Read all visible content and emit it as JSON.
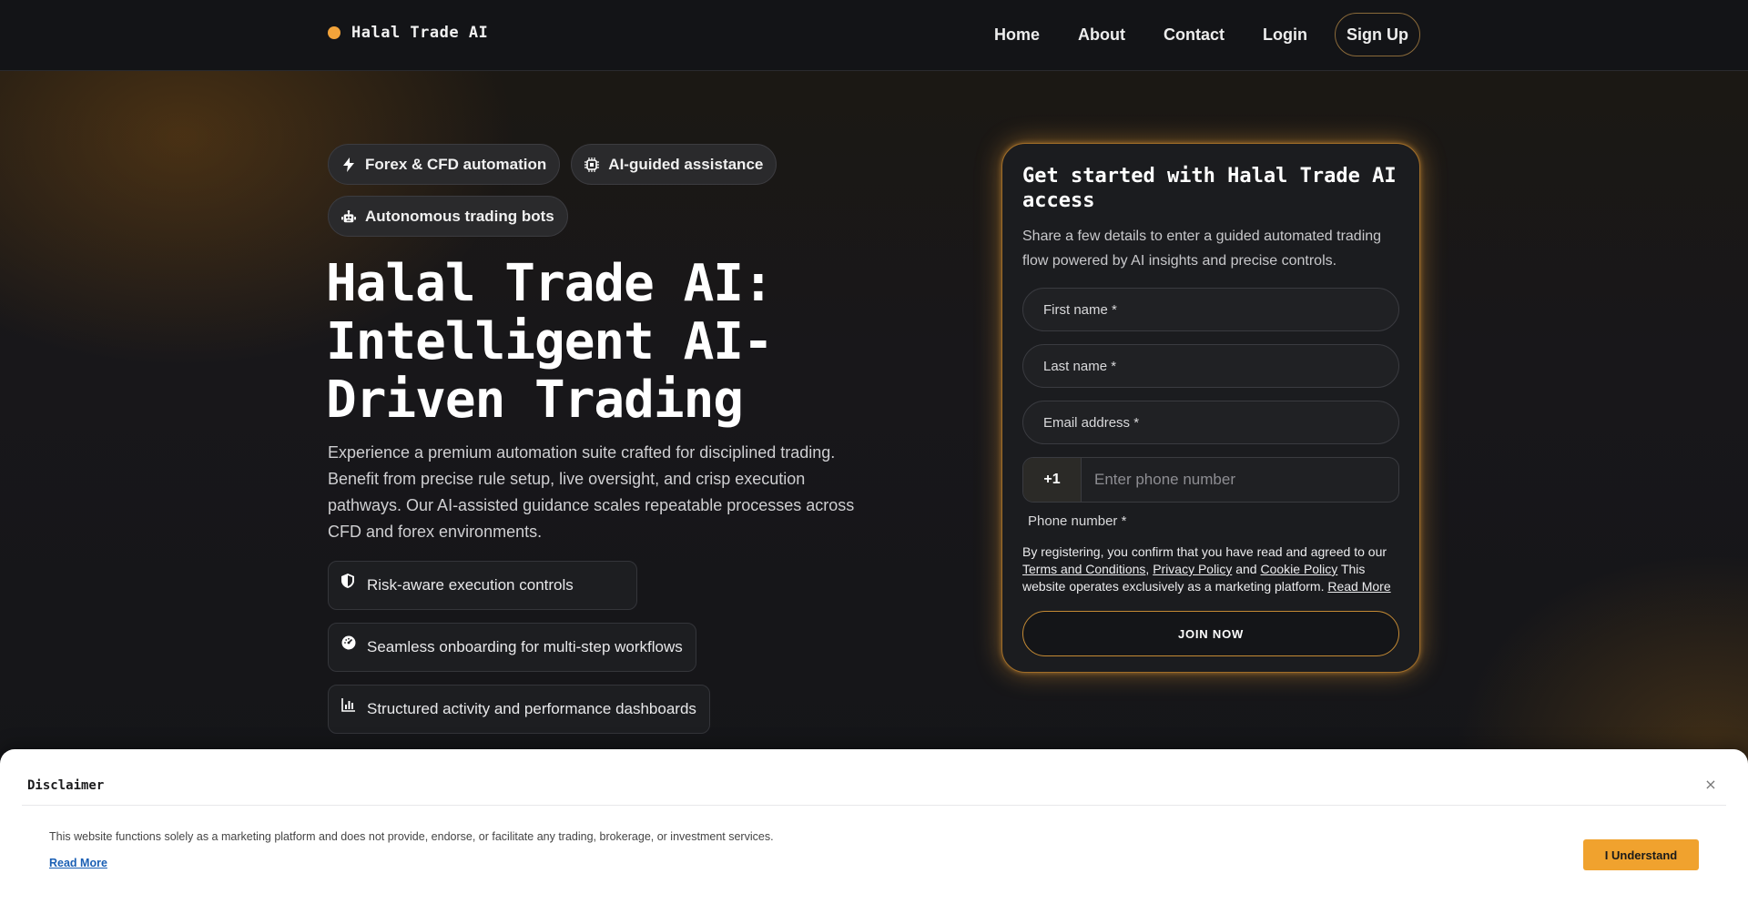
{
  "header": {
    "brand": "Halal Trade AI",
    "nav": {
      "home": "Home",
      "about": "About",
      "contact": "Contact",
      "login": "Login",
      "signup": "Sign Up"
    }
  },
  "hero": {
    "chips": [
      {
        "label": "Forex & CFD automation",
        "icon": "bolt-icon"
      },
      {
        "label": "AI-guided assistance",
        "icon": "chip-icon"
      },
      {
        "label": "Autonomous trading bots",
        "icon": "robot-icon"
      }
    ],
    "title": "Halal Trade AI: Intelligent AI-Driven Trading",
    "text": "Experience a premium automation suite crafted for disciplined trading. Benefit from precise rule setup, live oversight, and crisp execution pathways. Our AI-assisted guidance scales repeatable processes across CFD and forex environments.",
    "features": [
      {
        "label": "Risk-aware execution controls",
        "icon": "shield-icon"
      },
      {
        "label": "Seamless onboarding for multi-step workflows",
        "icon": "gauge-icon"
      },
      {
        "label": "Structured activity and performance dashboards",
        "icon": "bar-chart-icon"
      }
    ]
  },
  "form": {
    "title": "Get started with Halal Trade AI access",
    "subtitle": "Share a few details to enter a guided automated trading flow powered by AI insights and precise controls.",
    "first_name": "First name *",
    "last_name": "Last name *",
    "email": "Email address *",
    "phone_code": "+1",
    "phone_placeholder": "Enter phone number",
    "phone_label": "Phone number *",
    "legal_prefix": "By registering, you confirm that you have read and agreed to our",
    "terms": "Terms and Conditions",
    "privacy": "Privacy Policy",
    "and": "and",
    "cookie": "Cookie Policy",
    "legal_suffix": "This website operates exclusively as a marketing platform.",
    "read_more": "Read More",
    "join": "JOIN NOW"
  },
  "disclaimer": {
    "title": "Disclaimer",
    "close": "×",
    "text": "This website functions solely as a marketing platform and does not provide, endorse, or facilitate any trading, brokerage, or investment services.",
    "read_more": "Read More",
    "button": "I Understand"
  },
  "colors": {
    "accent": "#f2a33a",
    "background": "#141518",
    "card_border": "#a06d28",
    "disclaimer_button": "#f0a22e"
  }
}
